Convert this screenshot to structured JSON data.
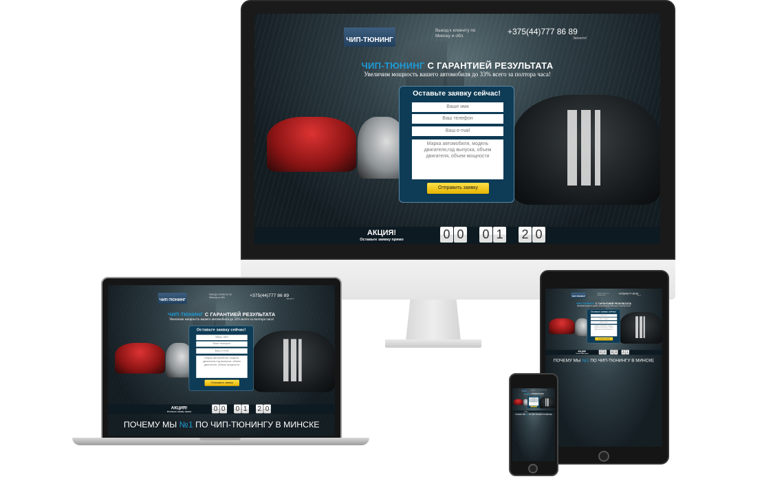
{
  "site": {
    "logo_text": "ЧИП-ТЮНИНГ",
    "visit_text": "Выезд к клиенту по Минску и обл.",
    "phone": "+375(44)777 86 89",
    "call_label": "Звоните!",
    "headline_accent": "ЧИП-ТЮНИНГ",
    "headline_rest": " С ГАРАНТИЕЙ РЕЗУЛЬТАТА",
    "subtitle": "Увеличим мощность вашего автомобиля до 33% всего за полтора часа!",
    "form": {
      "title": "Оставьте заявку сейчас!",
      "name_placeholder": "Ваше имя",
      "phone_placeholder": "Ваш телефон",
      "email_placeholder": "Ваш e-mail",
      "details_placeholder": "Марка автомобиля, модель двигателя,год выпуска, объем двигателя, объем мощности",
      "submit_label": "Отправить заявку"
    },
    "promo_title": "АКЦИЯ!",
    "promo_sub": "Оставьте заявку прямо",
    "why_prefix": "ПОЧЕМУ МЫ ",
    "why_accent": "№1",
    "why_rest": " ПО ЧИП-ТЮНИНГУ В МИНСКЕ"
  },
  "timers": {
    "monitor": [
      "00",
      "01",
      "20"
    ],
    "laptop": [
      "00",
      "01",
      "20"
    ],
    "tablet": [
      "00",
      "00",
      "31"
    ]
  },
  "colors": {
    "accent": "#1e9bd7",
    "form_bg": "#0e3b55",
    "button": "#f5c800"
  }
}
